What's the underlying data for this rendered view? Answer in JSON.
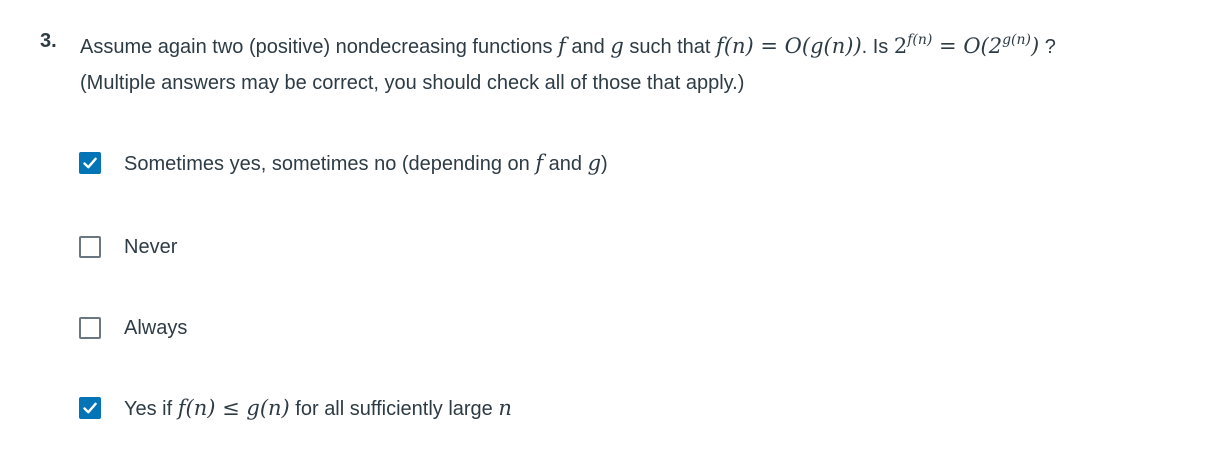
{
  "question": {
    "number": "3.",
    "line1_text_a": "Assume again two (positive) nondecreasing functions ",
    "f": "f",
    "and": " and ",
    "g": "g",
    "such_that": " such that ",
    "relation": "f(n) = O(g(n))",
    "is": ". Is ",
    "lhs_base": "2",
    "lhs_exp": "f(n)",
    "eq_O": " = O(2",
    "rhs_exp": "g(n)",
    "close": ")",
    "qmark": " ?",
    "line2": "(Multiple answers may be correct, you should check all of those that apply.)"
  },
  "options": [
    {
      "text_a": "Sometimes yes, sometimes no (depending on ",
      "math_a": "f",
      "text_b": " and ",
      "math_b": "g",
      "text_c": ")",
      "checked": true
    },
    {
      "text_a": "Never",
      "checked": false
    },
    {
      "text_a": "Always",
      "checked": false
    },
    {
      "text_a": "Yes if ",
      "math_a": "f(n) ≤ g(n)",
      "text_b": " for all sufficiently large ",
      "math_b": "n",
      "checked": true
    }
  ],
  "colors": {
    "checkbox_checked": "#0374b5",
    "checkbox_border": "#6b7780",
    "text": "#2d3b45"
  }
}
